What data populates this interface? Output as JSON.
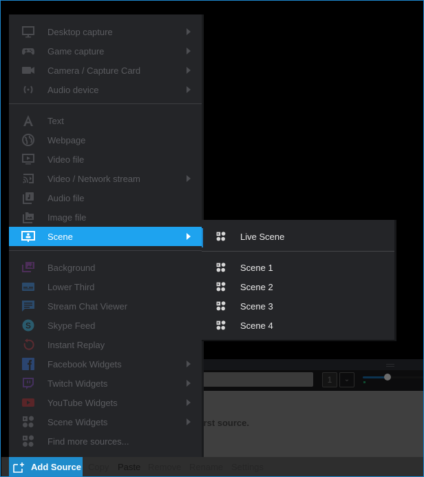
{
  "menu": {
    "groups": [
      [
        {
          "label": "Desktop capture",
          "icon": "monitor-icon",
          "submenu": true
        },
        {
          "label": "Game capture",
          "icon": "gamepad-icon",
          "submenu": true
        },
        {
          "label": "Camera / Capture Card",
          "icon": "camera-icon",
          "submenu": true
        },
        {
          "label": "Audio device",
          "icon": "audio-device-icon",
          "submenu": true
        }
      ],
      [
        {
          "label": "Text",
          "icon": "text-icon",
          "submenu": false
        },
        {
          "label": "Webpage",
          "icon": "globe-icon",
          "submenu": false
        },
        {
          "label": "Video file",
          "icon": "video-file-icon",
          "submenu": false
        },
        {
          "label": "Video / Network stream",
          "icon": "cast-icon",
          "submenu": true
        },
        {
          "label": "Audio file",
          "icon": "audio-file-icon",
          "submenu": false
        },
        {
          "label": "Image file",
          "icon": "image-file-icon",
          "submenu": false
        },
        {
          "label": "Scene",
          "icon": "scene-icon",
          "submenu": true,
          "active": true
        }
      ],
      [
        {
          "label": "Background",
          "icon": "background-icon",
          "submenu": false
        },
        {
          "label": "Lower Third",
          "icon": "lower-third-icon",
          "submenu": false
        },
        {
          "label": "Stream Chat Viewer",
          "icon": "chat-icon",
          "submenu": false
        },
        {
          "label": "Skype Feed",
          "icon": "skype-icon",
          "submenu": false
        },
        {
          "label": "Instant Replay",
          "icon": "replay-icon",
          "submenu": false
        },
        {
          "label": "Facebook Widgets",
          "icon": "facebook-icon",
          "submenu": true
        },
        {
          "label": "Twitch Widgets",
          "icon": "twitch-icon",
          "submenu": true
        },
        {
          "label": "YouTube Widgets",
          "icon": "youtube-icon",
          "submenu": true
        },
        {
          "label": "Scene Widgets",
          "icon": "widgets-icon",
          "submenu": true
        },
        {
          "label": "Find more sources...",
          "icon": "widgets-icon",
          "submenu": false
        }
      ]
    ]
  },
  "submenu": {
    "live": {
      "label": "Live Scene",
      "icon": "scene-widget-icon"
    },
    "scenes": [
      {
        "label": "Scene 1",
        "icon": "scene-widget-icon"
      },
      {
        "label": "Scene 2",
        "icon": "scene-widget-icon"
      },
      {
        "label": "Scene 3",
        "icon": "scene-widget-icon"
      },
      {
        "label": "Scene 4",
        "icon": "scene-widget-icon"
      }
    ]
  },
  "toolbar": {
    "add_source": "Add Source",
    "copy": "Copy",
    "paste": "Paste",
    "remove": "Remove",
    "rename": "Rename",
    "settings": "Settings"
  },
  "background": {
    "hint_text": "Add your first source.",
    "scene_number": "1",
    "volume_level": 0.4
  },
  "colors": {
    "accent": "#1ea3ef",
    "button_blue": "#1f8ccc",
    "menu_bg": "#242528"
  }
}
